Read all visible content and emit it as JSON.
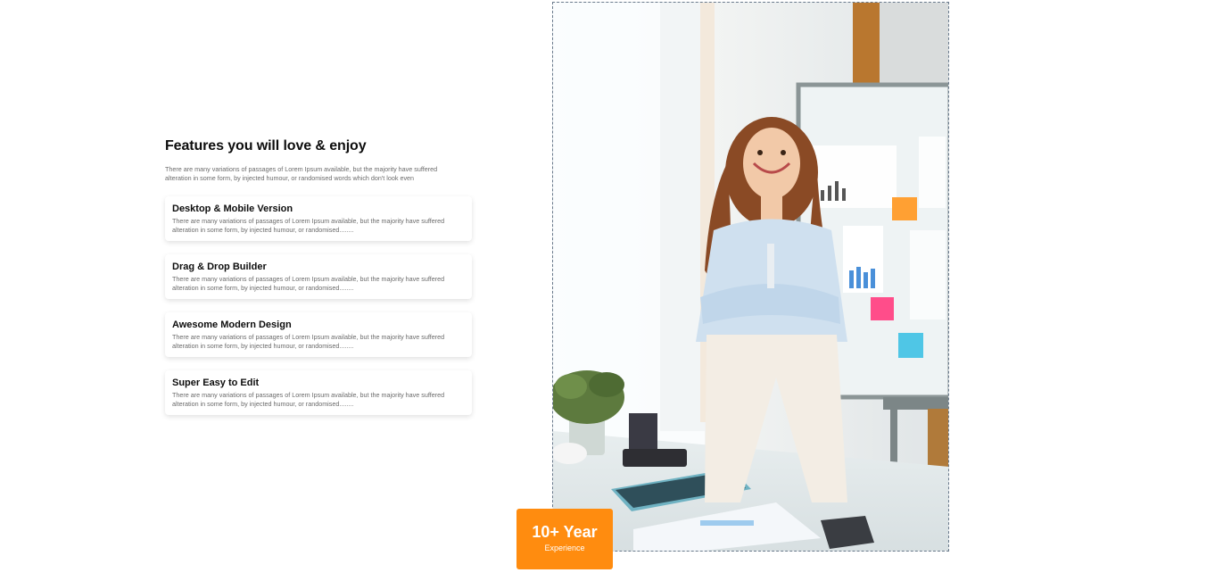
{
  "features": {
    "heading": "Features you will love & enjoy",
    "intro": "There are many variations of passages of Lorem Ipsum available, but the majority have suffered alteration in some form, by injected humour, or randomised words which don't look even",
    "cards": [
      {
        "title": "Desktop & Mobile Version",
        "desc": "There are many variations of passages of Lorem Ipsum available, but the majority have suffered alteration in some form, by injected humour, or randomised........"
      },
      {
        "title": "Drag & Drop Builder",
        "desc": "There are many variations of passages of Lorem Ipsum available, but the majority have suffered alteration in some form, by injected humour, or randomised........"
      },
      {
        "title": "Awesome Modern Design",
        "desc": "There are many variations of passages of Lorem Ipsum available, but the majority have suffered alteration in some form, by injected humour, or randomised........"
      },
      {
        "title": "Super Easy to Edit",
        "desc": "There are many variations of passages of Lorem Ipsum available, but the majority have suffered alteration in some form, by injected humour, or randomised........"
      }
    ]
  },
  "badge": {
    "value": "10+ Year",
    "label": "Experience",
    "color": "#ff8c0f"
  },
  "photo": {
    "icon": "office-woman-photo"
  }
}
